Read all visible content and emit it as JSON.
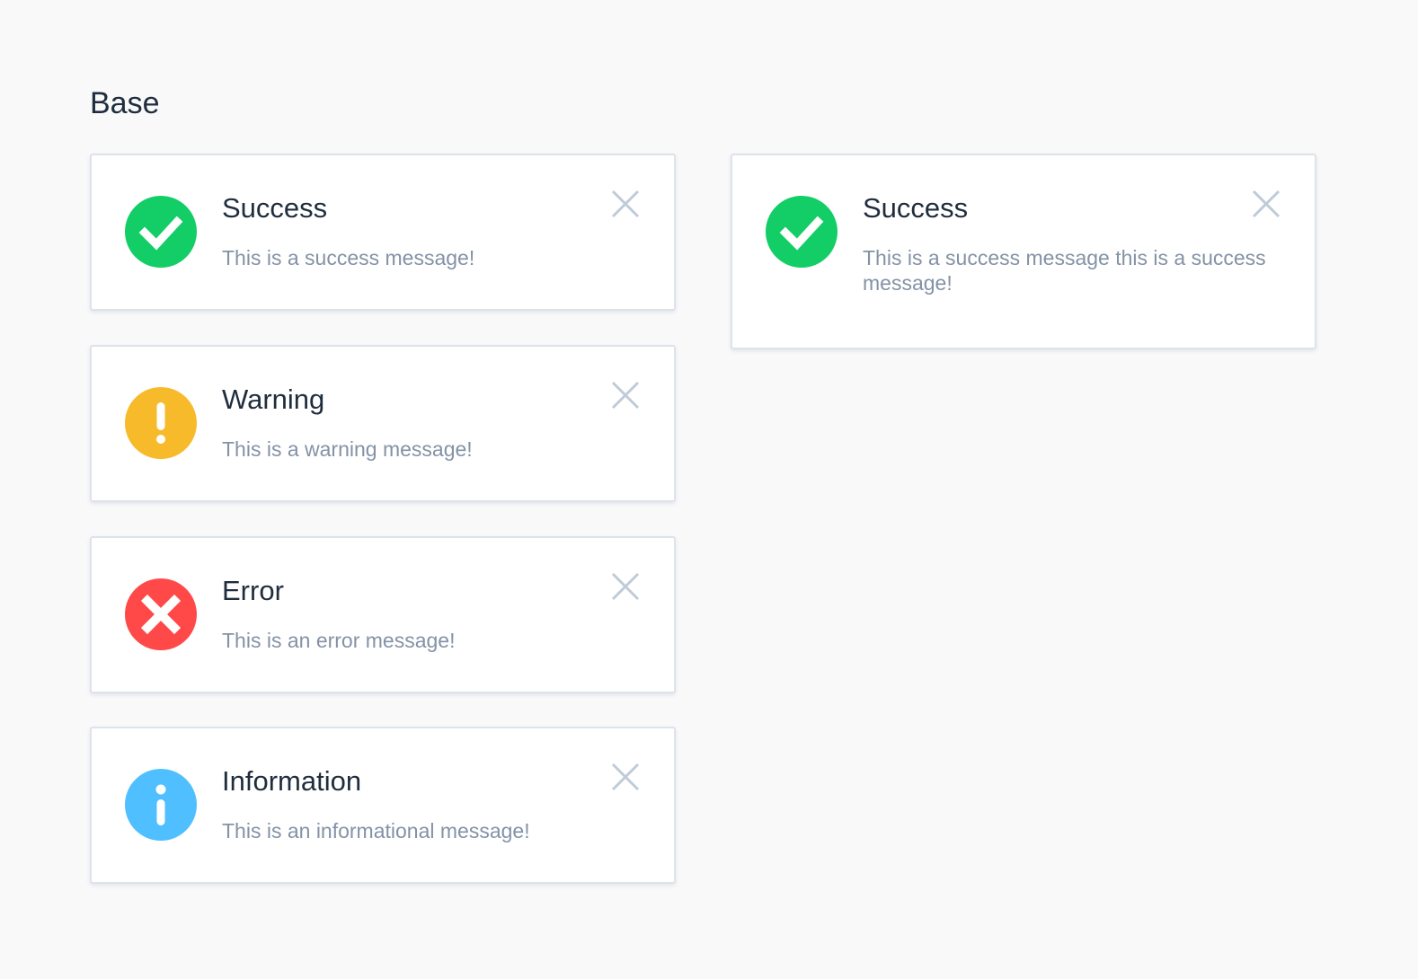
{
  "section": {
    "title": "Base"
  },
  "colors": {
    "success": "#13ce66",
    "warning": "#f7ba2a",
    "error": "#ff4949",
    "info": "#50bfff",
    "title_text": "#1f2d3d",
    "message_text": "#8492a6",
    "close_icon": "#bfcbd9"
  },
  "toasts": [
    {
      "type": "success",
      "icon": "check-circle-icon",
      "title": "Success",
      "message": "This is a success message!"
    },
    {
      "type": "warning",
      "icon": "exclamation-circle-icon",
      "title": "Warning",
      "message": "This is a warning message!"
    },
    {
      "type": "error",
      "icon": "x-circle-icon",
      "title": "Error",
      "message": "This is an error message!"
    },
    {
      "type": "info",
      "icon": "info-circle-icon",
      "title": "Information",
      "message": "This is an informational message!"
    },
    {
      "type": "success",
      "icon": "check-circle-icon",
      "title": "Success",
      "message": "This is a success message this is a success message!"
    }
  ],
  "close_icon": "close-icon"
}
